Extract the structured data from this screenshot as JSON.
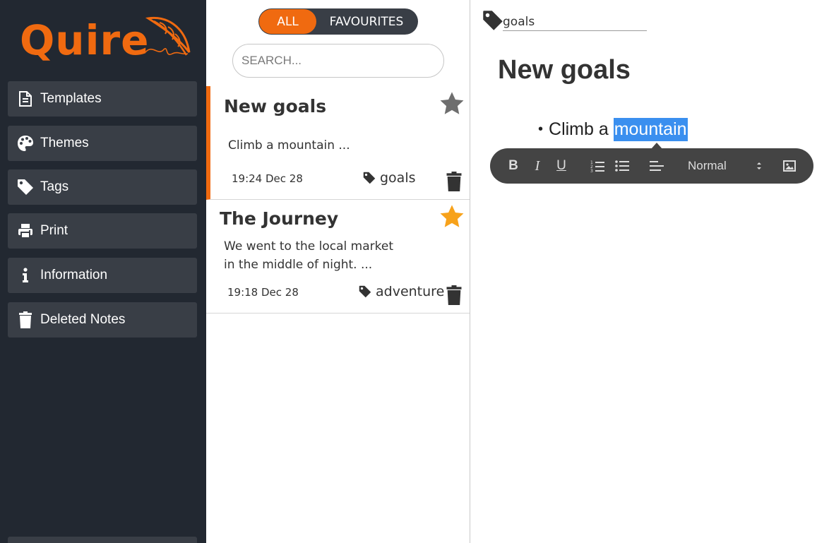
{
  "app": {
    "name": "Quire"
  },
  "sidebar": {
    "items": [
      {
        "label": "Templates",
        "icon": "file-icon"
      },
      {
        "label": "Themes",
        "icon": "palette-icon"
      },
      {
        "label": "Tags",
        "icon": "tag-icon"
      },
      {
        "label": "Print",
        "icon": "printer-icon"
      },
      {
        "label": "Information",
        "icon": "info-icon"
      },
      {
        "label": "Deleted Notes",
        "icon": "trash-icon"
      }
    ]
  },
  "list": {
    "filter": {
      "all": "ALL",
      "favourites": "FAVOURITES",
      "selected": "all"
    },
    "search": {
      "placeholder": "SEARCH...",
      "value": ""
    },
    "notes": [
      {
        "title": "New goals",
        "preview": "Climb a mountain ...",
        "date": "19:24 Dec 28",
        "tag": "goals",
        "favourite": false,
        "selected": true
      },
      {
        "title": "The Journey",
        "preview_line1": "We went to the local market",
        "preview_line2": "in the middle of night. ...",
        "date": "19:18 Dec 28",
        "tag": "adventure",
        "favourite": true,
        "selected": false
      }
    ]
  },
  "editor": {
    "tag_value": "goals",
    "title": "New goals",
    "bullet_before": "Climb a ",
    "bullet_selected": "mountain",
    "toolbar": {
      "bold": "B",
      "italic": "I",
      "underline": "U",
      "format": "Normal",
      "buttons": [
        "bold-icon",
        "italic-icon",
        "underline-icon",
        "ordered-list-icon",
        "bullet-list-icon",
        "align-icon",
        "image-icon"
      ]
    }
  },
  "colors": {
    "accent": "#f06a10",
    "sidebar_bg": "#222831",
    "sidebar_item": "#393e46",
    "star_inactive": "#6e6e6e",
    "star_active": "#f7a21b",
    "selection": "#3a8fef",
    "toolbar_bg": "#444444"
  }
}
